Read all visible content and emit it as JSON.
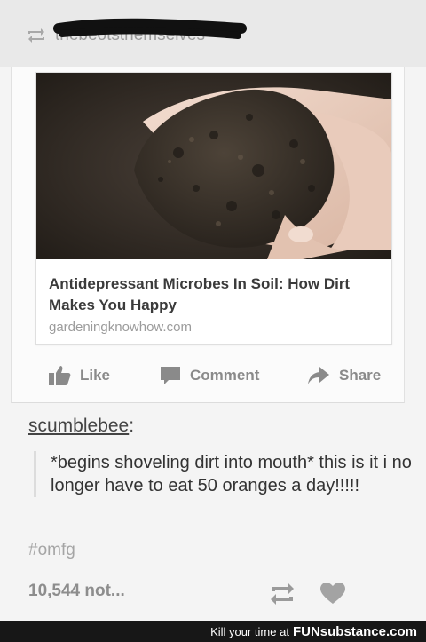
{
  "reblog": {
    "source_name_obscured": "thebeotsthemselves"
  },
  "link_card": {
    "title": "Antidepressant Microbes In Soil: How Dirt Makes You Happy",
    "domain": "gardeningknowhow.com"
  },
  "actions": {
    "like_label": "Like",
    "comment_label": "Comment",
    "share_label": "Share"
  },
  "post": {
    "username": "scumblebee",
    "username_suffix": ":",
    "quote": "*begins shoveling dirt into mouth* this is it i no longer have to eat 50 oranges a day!!!!!",
    "tag": "#omfg",
    "notes": "10,544 not..."
  },
  "footer": {
    "prefix": "Kill your time at",
    "brand": "FUNsubstance.com"
  },
  "colors": {
    "footer_bg": "#171717",
    "text_dark": "#333333",
    "text_muted": "#8d8d8d"
  }
}
